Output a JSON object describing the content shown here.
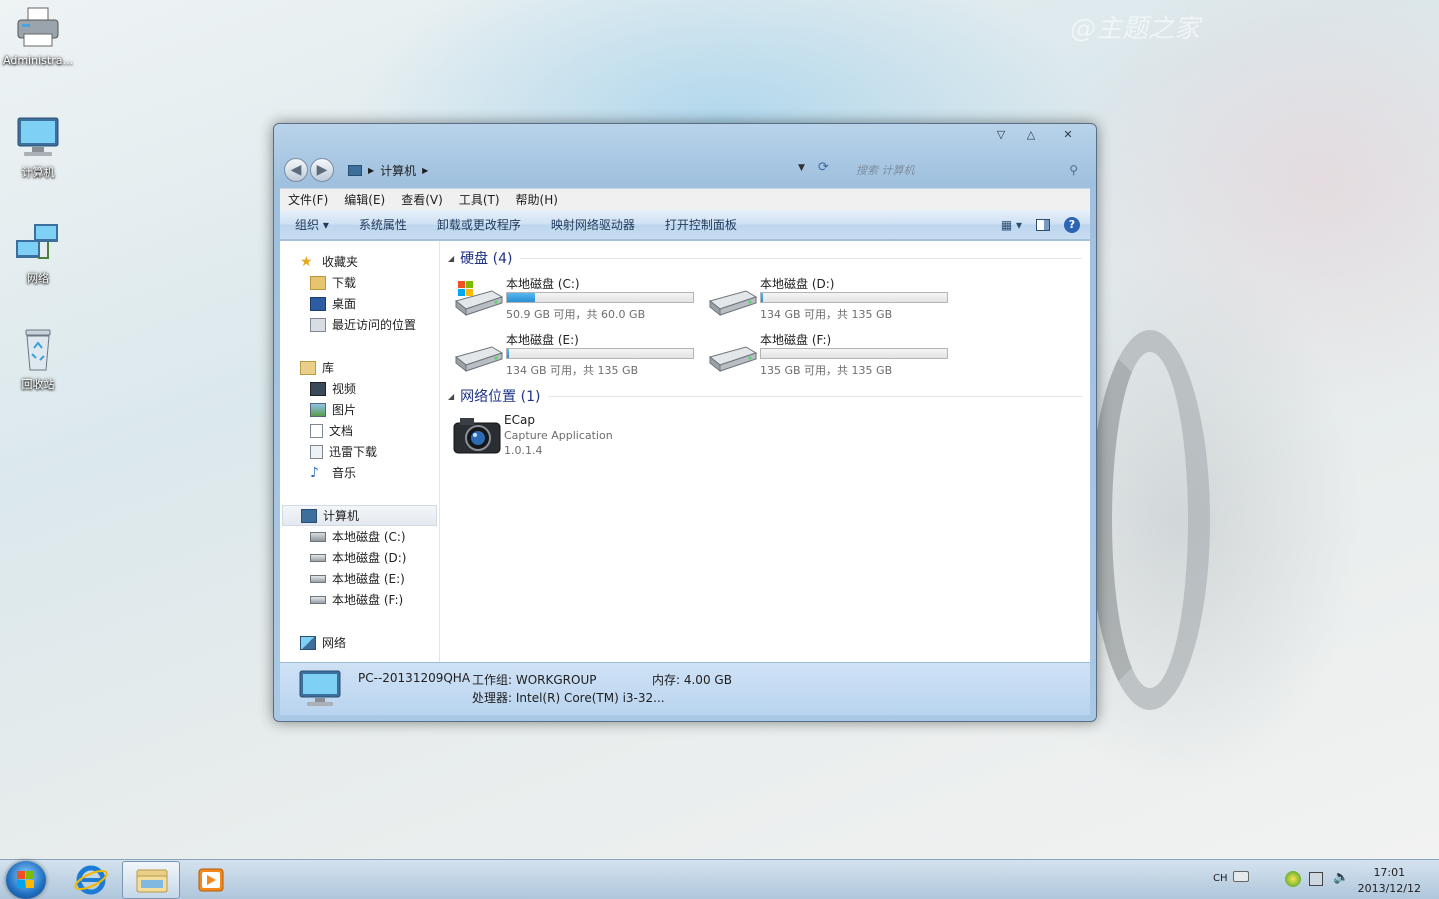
{
  "desktop": {
    "icons": [
      {
        "label": "Administra..."
      },
      {
        "label": "计算机"
      },
      {
        "label": "网络"
      },
      {
        "label": "回收站"
      }
    ],
    "watermark": "@主题之家"
  },
  "window": {
    "address": {
      "crumb": "计算机"
    },
    "search": {
      "placeholder": "搜索 计算机"
    },
    "menu": [
      "文件(F)",
      "编辑(E)",
      "查看(V)",
      "工具(T)",
      "帮助(H)"
    ],
    "toolbar": [
      "组织 ▾",
      "系统属性",
      "卸载或更改程序",
      "映射网络驱动器",
      "打开控制面板"
    ],
    "nav": {
      "favorites": {
        "label": "收藏夹",
        "items": [
          "下载",
          "桌面",
          "最近访问的位置"
        ]
      },
      "libraries": {
        "label": "库",
        "items": [
          "视频",
          "图片",
          "文档",
          "迅雷下载",
          "音乐"
        ]
      },
      "computer": {
        "label": "计算机",
        "items": [
          "本地磁盘 (C:)",
          "本地磁盘 (D:)",
          "本地磁盘 (E:)",
          "本地磁盘 (F:)"
        ]
      },
      "network": {
        "label": "网络"
      }
    },
    "groups": {
      "harddisk": {
        "title": "硬盘 (4)"
      },
      "netloc": {
        "title": "网络位置 (1)"
      }
    },
    "drives": [
      {
        "name": "本地磁盘 (C:)",
        "size": "50.9 GB 可用，共 60.0 GB",
        "used_fraction": 0.15
      },
      {
        "name": "本地磁盘 (D:)",
        "size": "134 GB 可用，共 135 GB",
        "used_fraction": 0.01
      },
      {
        "name": "本地磁盘 (E:)",
        "size": "134 GB 可用，共 135 GB",
        "used_fraction": 0.01
      },
      {
        "name": "本地磁盘 (F:)",
        "size": "135 GB 可用，共 135 GB",
        "used_fraction": 0.0
      }
    ],
    "netitem": {
      "name": "ECap",
      "desc": "Capture Application",
      "version": "1.0.1.4"
    },
    "details": {
      "pcname": "PC--20131209QHA",
      "workgroup": "工作组: WORKGROUP",
      "memory": "内存: 4.00 GB",
      "cpu": "处理器: Intel(R) Core(TM) i3-32..."
    }
  },
  "taskbar": {
    "tray": {
      "lang": "CH"
    },
    "clock": {
      "time": "17:01",
      "date": "2013/12/12"
    }
  },
  "colors": {
    "accent": "#2a8ed4",
    "group_title": "#1e3287"
  }
}
